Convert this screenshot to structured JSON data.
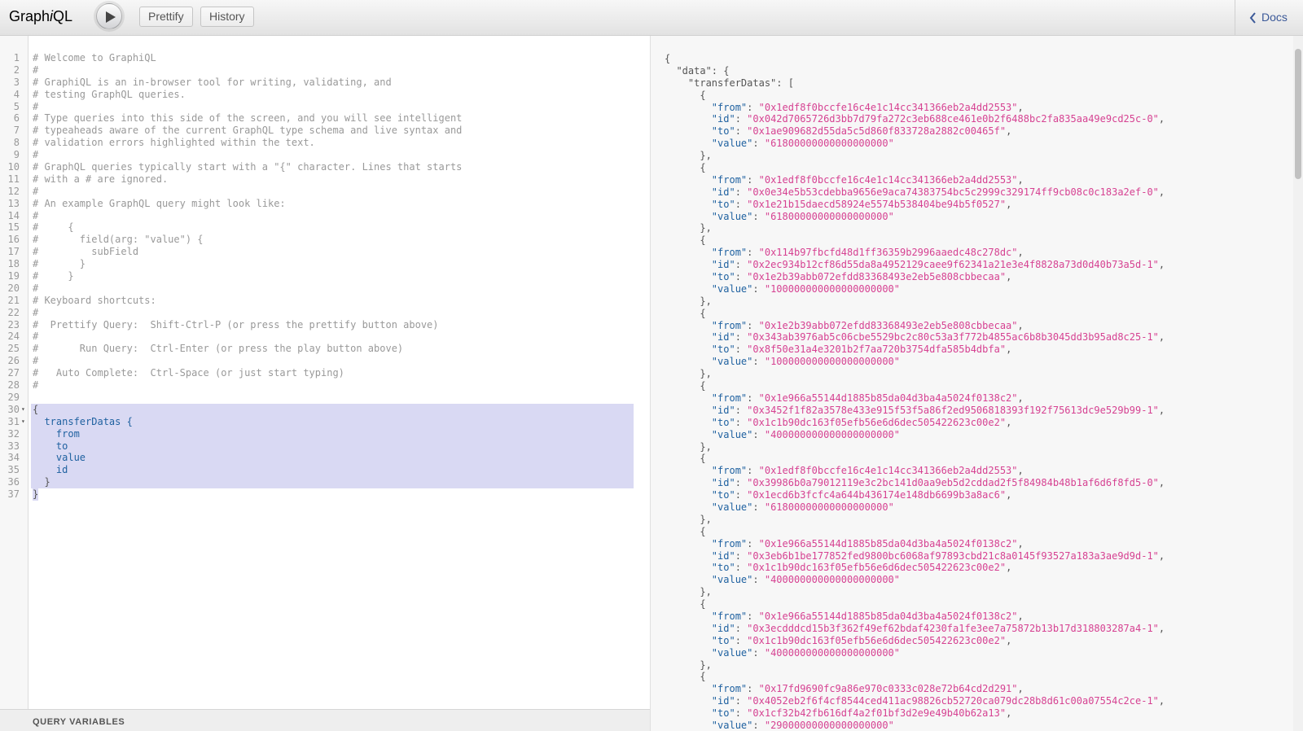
{
  "header": {
    "logo_pre": "Graph",
    "logo_i": "i",
    "logo_post": "QL",
    "prettify_label": "Prettify",
    "history_label": "History",
    "docs_label": "Docs"
  },
  "editor": {
    "lines": [
      {
        "n": "1",
        "t": "# Welcome to GraphiQL",
        "c": "com"
      },
      {
        "n": "2",
        "t": "#",
        "c": "com"
      },
      {
        "n": "3",
        "t": "# GraphiQL is an in-browser tool for writing, validating, and",
        "c": "com"
      },
      {
        "n": "4",
        "t": "# testing GraphQL queries.",
        "c": "com"
      },
      {
        "n": "5",
        "t": "#",
        "c": "com"
      },
      {
        "n": "6",
        "t": "# Type queries into this side of the screen, and you will see intelligent",
        "c": "com"
      },
      {
        "n": "7",
        "t": "# typeaheads aware of the current GraphQL type schema and live syntax and",
        "c": "com"
      },
      {
        "n": "8",
        "t": "# validation errors highlighted within the text.",
        "c": "com"
      },
      {
        "n": "9",
        "t": "#",
        "c": "com"
      },
      {
        "n": "10",
        "t": "# GraphQL queries typically start with a \"{\" character. Lines that starts",
        "c": "com"
      },
      {
        "n": "11",
        "t": "# with a # are ignored.",
        "c": "com"
      },
      {
        "n": "12",
        "t": "#",
        "c": "com"
      },
      {
        "n": "13",
        "t": "# An example GraphQL query might look like:",
        "c": "com"
      },
      {
        "n": "14",
        "t": "#",
        "c": "com"
      },
      {
        "n": "15",
        "t": "#     {",
        "c": "com"
      },
      {
        "n": "16",
        "t": "#       field(arg: \"value\") {",
        "c": "com"
      },
      {
        "n": "17",
        "t": "#         subField",
        "c": "com"
      },
      {
        "n": "18",
        "t": "#       }",
        "c": "com"
      },
      {
        "n": "19",
        "t": "#     }",
        "c": "com"
      },
      {
        "n": "20",
        "t": "#",
        "c": "com"
      },
      {
        "n": "21",
        "t": "# Keyboard shortcuts:",
        "c": "com"
      },
      {
        "n": "22",
        "t": "#",
        "c": "com"
      },
      {
        "n": "23",
        "t": "#  Prettify Query:  Shift-Ctrl-P (or press the prettify button above)",
        "c": "com"
      },
      {
        "n": "24",
        "t": "#",
        "c": "com"
      },
      {
        "n": "25",
        "t": "#       Run Query:  Ctrl-Enter (or press the play button above)",
        "c": "com"
      },
      {
        "n": "26",
        "t": "#",
        "c": "com"
      },
      {
        "n": "27",
        "t": "#   Auto Complete:  Ctrl-Space (or just start typing)",
        "c": "com"
      },
      {
        "n": "28",
        "t": "#",
        "c": "com"
      },
      {
        "n": "29",
        "t": "",
        "c": "com"
      },
      {
        "n": "30",
        "t": "{",
        "c": "p",
        "fold": true,
        "sel": true
      },
      {
        "n": "31",
        "t": "  transferDatas {",
        "c": "kw",
        "fold": true,
        "sel": true
      },
      {
        "n": "32",
        "t": "    from",
        "c": "kw",
        "sel": true
      },
      {
        "n": "33",
        "t": "    to",
        "c": "kw",
        "sel": true
      },
      {
        "n": "34",
        "t": "    value",
        "c": "kw",
        "sel": true
      },
      {
        "n": "35",
        "t": "    id",
        "c": "kw",
        "sel": true
      },
      {
        "n": "36",
        "t": "  }",
        "c": "p",
        "sel": true
      },
      {
        "n": "37",
        "t": "}",
        "c": "p",
        "lastsel": true
      }
    ]
  },
  "query_variables_label": "QUERY VARIABLES",
  "result": {
    "open_lines": [
      "{",
      "  \"data\": {",
      "    \"transferDatas\": ["
    ],
    "records": [
      {
        "from": "0x1edf8f0bccfe16c4e1c14cc341366eb2a4dd2553",
        "id": "0x042d7065726d3bb7d79fa272c3eb688ce461e0b2f6488bc2fa835aa49e9cd25c-0",
        "to": "0x1ae909682d55da5c5d860f833728a2882c00465f",
        "value": "61800000000000000000"
      },
      {
        "from": "0x1edf8f0bccfe16c4e1c14cc341366eb2a4dd2553",
        "id": "0x0e34e5b53cdebba9656e9aca74383754bc5c2999c329174ff9cb08c0c183a2ef-0",
        "to": "0x1e21b15daecd58924e5574b538404be94b5f0527",
        "value": "61800000000000000000"
      },
      {
        "from": "0x114b97fbcfd48d1ff36359b2996aaedc48c278dc",
        "id": "0x2ec934b12cf86d55da8a4952129caee9f62341a21e3e4f8828a73d0d40b73a5d-1",
        "to": "0x1e2b39abb072efdd83368493e2eb5e808cbbecaa",
        "value": "100000000000000000000"
      },
      {
        "from": "0x1e2b39abb072efdd83368493e2eb5e808cbbecaa",
        "id": "0x343ab3976ab5c06cbe5529bc2c80c53a3f772b4855ac6b8b3045dd3b95ad8c25-1",
        "to": "0x8f50e31a4e3201b2f7aa720b3754dfa585b4dbfa",
        "value": "100000000000000000000"
      },
      {
        "from": "0x1e966a55144d1885b85da04d3ba4a5024f0138c2",
        "id": "0x3452f1f82a3578e433e915f53f5a86f2ed9506818393f192f75613dc9e529b99-1",
        "to": "0x1c1b90dc163f05efb56e6d6dec505422623c00e2",
        "value": "400000000000000000000"
      },
      {
        "from": "0x1edf8f0bccfe16c4e1c14cc341366eb2a4dd2553",
        "id": "0x39986b0a79012119e3c2bc141d0aa9eb5d2cddad2f5f84984b48b1af6d6f8fd5-0",
        "to": "0x1ecd6b3fcfc4a644b436174e148db6699b3a8ac6",
        "value": "61800000000000000000"
      },
      {
        "from": "0x1e966a55144d1885b85da04d3ba4a5024f0138c2",
        "id": "0x3eb6b1be177852fed9800bc6068af97893cbd21c8a0145f93527a183a3ae9d9d-1",
        "to": "0x1c1b90dc163f05efb56e6d6dec505422623c00e2",
        "value": "400000000000000000000"
      },
      {
        "from": "0x1e966a55144d1885b85da04d3ba4a5024f0138c2",
        "id": "0x3ecdddcd15b3f362f49ef62bdaf4230fa1fe3ee7a75872b13b17d318803287a4-1",
        "to": "0x1c1b90dc163f05efb56e6d6dec505422623c00e2",
        "value": "400000000000000000000"
      },
      {
        "from": "0x17fd9690fc9a86e970c0333c028e72b64cd2d291",
        "id": "0x4052eb2f6f4cf8544ced411ac98826cb52720ca079dc28b8d61c00a07554c2ce-1",
        "to": "0x1cf32b42fb616df4a2f01bf3d2e9e49b40b62a13",
        "value": "29000000000000000000"
      }
    ]
  }
}
